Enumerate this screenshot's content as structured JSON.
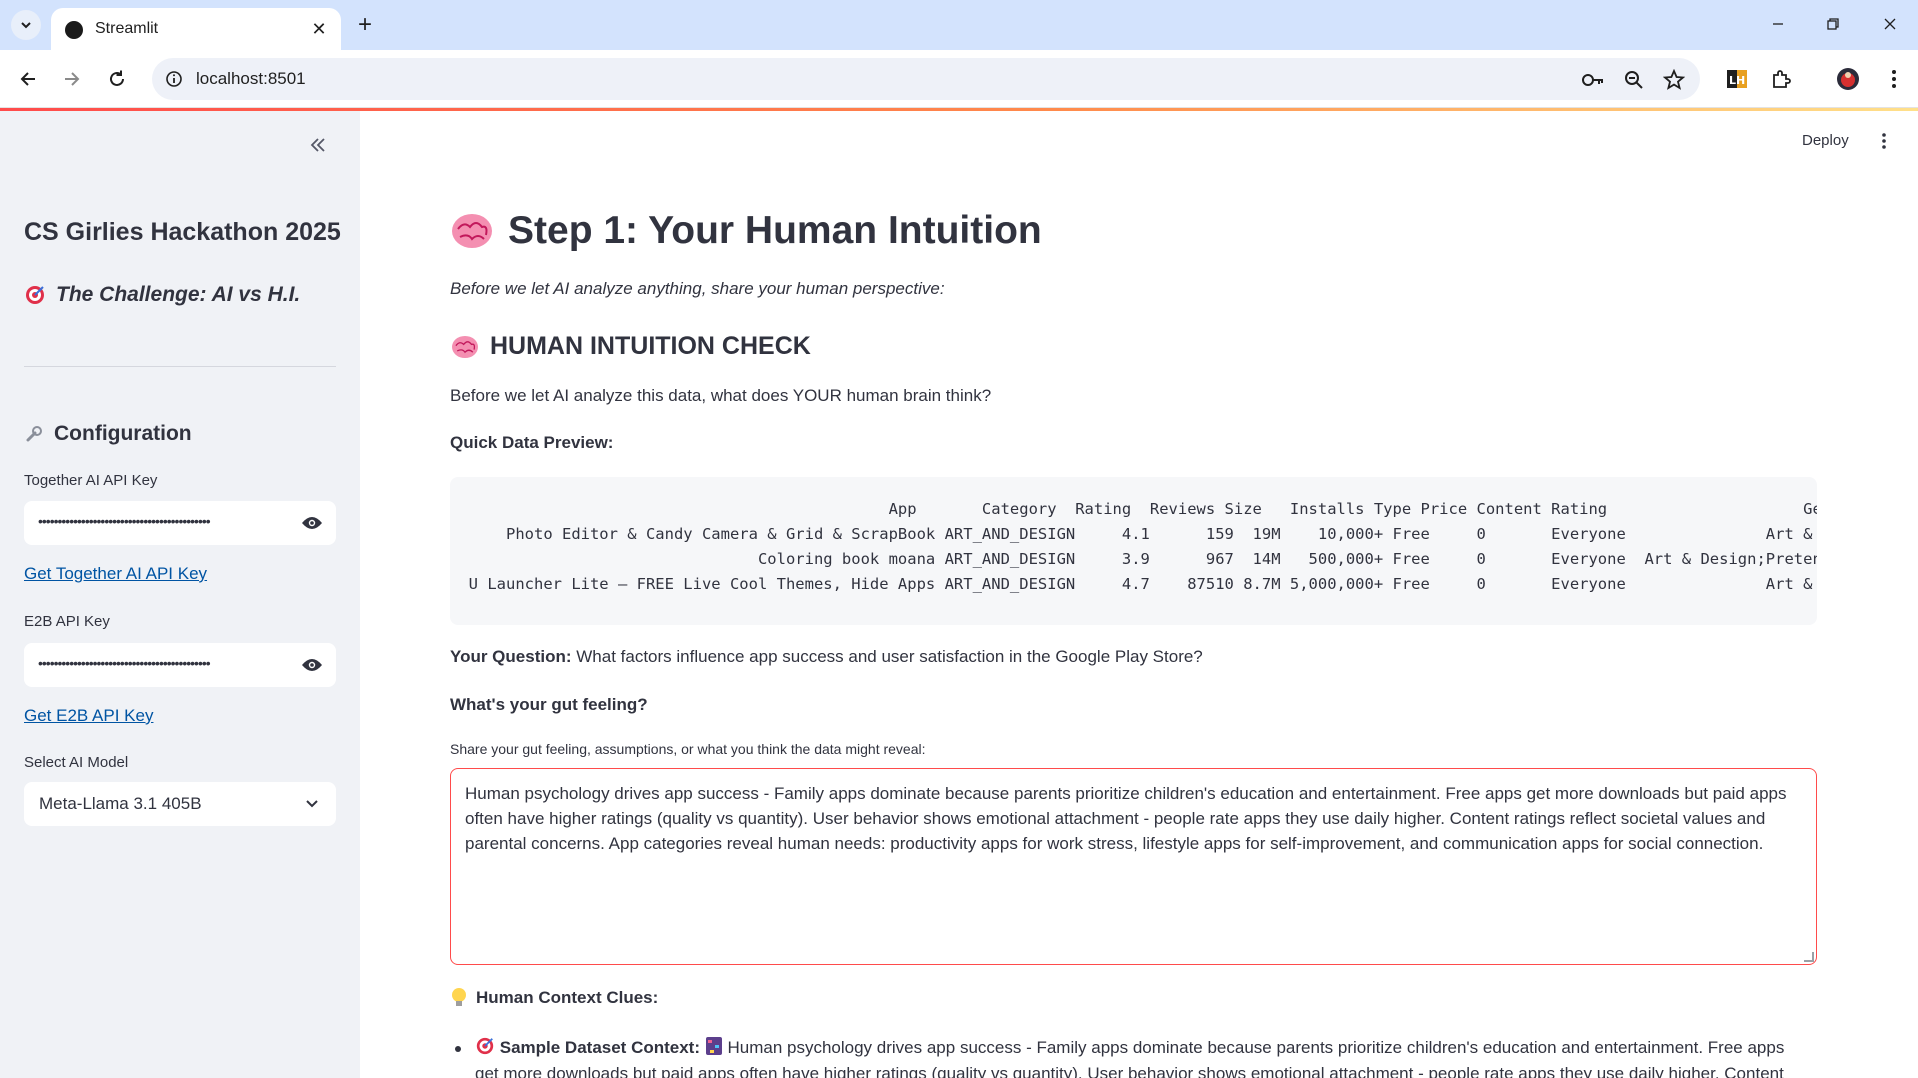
{
  "browser": {
    "tab_title": "Streamlit",
    "url": "localhost:8501"
  },
  "sidebar": {
    "title": "CS Girlies Hackathon 2025",
    "challenge": "The Challenge: AI vs H.I.",
    "config_heading": "Configuration",
    "together_label": "Together AI API Key",
    "together_value": "••••••••••••••••••••••••••••••••••••••••••••",
    "together_link": "Get Together AI API Key",
    "e2b_label": "E2B API Key",
    "e2b_value": "••••••••••••••••••••••••••••••••••••••••••••",
    "e2b_link": "Get E2B API Key",
    "model_label": "Select AI Model",
    "model_value": "Meta-Llama 3.1 405B"
  },
  "header": {
    "deploy_label": "Deploy"
  },
  "main": {
    "title": "Step 1: Your Human Intuition",
    "intro": "Before we let AI analyze anything, share your human perspective:",
    "section_heading": "HUMAN INTUITION CHECK",
    "section_question": "Before we let AI analyze this data, what does YOUR human brain think?",
    "preview_label": "Quick Data Preview:",
    "preview_text": "                                               App       Category  Rating  Reviews Size   Installs Type Price Content Rating                     Genres\n      Photo Editor & Candy Camera & Grid & ScrapBook ART_AND_DESIGN     4.1      159  19M    10,000+ Free     0       Everyone               Art & Design\n                                 Coloring book moana ART_AND_DESIGN     3.9      967  14M   500,000+ Free     0       Everyone  Art & Design;Pretend Play\n  U Launcher Lite – FREE Live Cool Themes, Hide Apps ART_AND_DESIGN     4.7    87510 8.7M 5,000,000+ Free     0       Everyone               Art & Design",
    "question_label": "Your Question:",
    "question_text": "What factors influence app success and user satisfaction in the Google Play Store?",
    "gut_heading": "What's your gut feeling?",
    "textarea_label": "Share your gut feeling, assumptions, or what you think the data might reveal:",
    "textarea_value": "Human psychology drives app success - Family apps dominate because parents prioritize children's education and entertainment. Free apps get more downloads but paid apps often have higher ratings (quality vs quantity). User behavior shows emotional attachment - people rate apps they use daily higher. Content ratings reflect societal values and parental concerns. App categories reveal human needs: productivity apps for work stress, lifestyle apps for self-improvement, and communication apps for social connection.",
    "clues_heading": "Human Context Clues:",
    "clue_label": "Sample Dataset Context:",
    "clue_text": "Human psychology drives app success - Family apps dominate because parents prioritize children's education and entertainment. Free apps get more downloads but paid apps often have higher ratings (quality vs quantity). User behavior shows emotional attachment - people rate apps they use daily higher. Content ratings reflect societal values and parental concerns."
  },
  "colors": {
    "accent": "#ff4b4b",
    "sidebar_bg": "#f0f2f6",
    "link": "#0054a3",
    "text": "#31333f"
  }
}
